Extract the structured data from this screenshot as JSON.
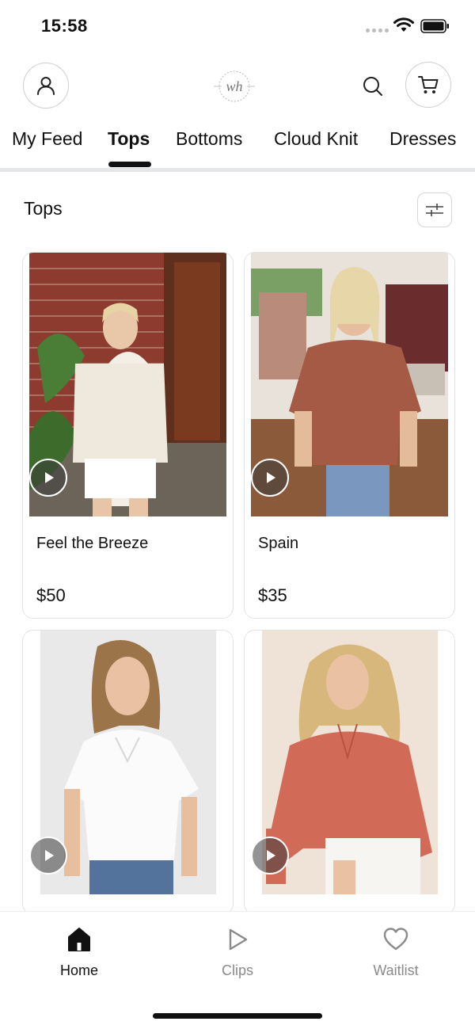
{
  "status_bar": {
    "time": "15:58"
  },
  "header": {
    "logo_alt": "wh",
    "account_icon": "person-icon",
    "search_icon": "search-icon",
    "cart_icon": "cart-icon"
  },
  "tabs": [
    {
      "label": "My Feed",
      "active": false
    },
    {
      "label": "Tops",
      "active": true
    },
    {
      "label": "Bottoms",
      "active": false
    },
    {
      "label": "Cloud Knit",
      "active": false
    },
    {
      "label": "Dresses",
      "active": false
    }
  ],
  "section": {
    "title": "Tops",
    "filter_icon": "sliders-icon"
  },
  "products": [
    {
      "name": "Feel the Breeze",
      "price": "$50"
    },
    {
      "name": "Spain",
      "price": "$35"
    },
    {
      "name": "",
      "price": ""
    },
    {
      "name": "",
      "price": ""
    }
  ],
  "bottom_nav": {
    "items": [
      {
        "label": "Home",
        "icon": "home-icon",
        "active": true
      },
      {
        "label": "Clips",
        "icon": "play-outline-icon",
        "active": false
      },
      {
        "label": "Waitlist",
        "icon": "heart-icon",
        "active": false
      }
    ]
  },
  "colors": {
    "text": "#111111",
    "inactive": "#8a8a8a",
    "divider": "#e4e6e8",
    "border": "#e3e3e3"
  }
}
